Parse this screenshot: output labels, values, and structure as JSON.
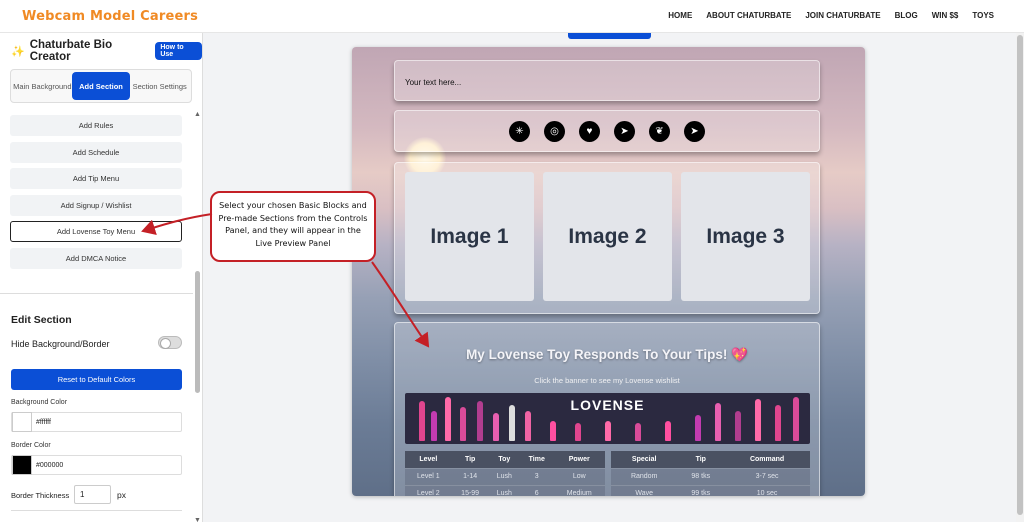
{
  "header": {
    "logo": "Webcam Model Careers",
    "nav": [
      "HOME",
      "ABOUT CHATURBATE",
      "JOIN CHATURBATE",
      "BLOG",
      "WIN $$",
      "TOYS"
    ]
  },
  "sidebar": {
    "title": "Chaturbate Bio Creator",
    "title_icon": "sparkles-icon",
    "howto": "How to Use",
    "tabs": [
      "Main Background",
      "Add Section",
      "Section Settings"
    ],
    "active_tab": "Add Section",
    "buttons": [
      "Add Rules",
      "Add Schedule",
      "Add Tip Menu",
      "Add Signup / Wishlist",
      "Add Lovense Toy Menu",
      "Add DMCA Notice"
    ],
    "edit": {
      "heading": "Edit Section",
      "hide_label": "Hide Background/Border",
      "reset": "Reset to Default Colors",
      "bg_label": "Background Color",
      "bg_value": "#ffffff",
      "border_label": "Border Color",
      "border_value": "#000000",
      "thick_label": "Border Thickness",
      "thick_value": "1",
      "thick_unit": "px"
    }
  },
  "callout": "Select your chosen Basic Blocks and Pre-made Sections from the Controls Panel, and they will appear in the Live Preview Panel",
  "preview": {
    "text_placeholder": "Your text here...",
    "socials": [
      "linktree-icon",
      "instagram-icon",
      "heart-link-icon",
      "telegram-icon",
      "onlyfans-icon",
      "telegram-icon"
    ],
    "images": [
      "Image 1",
      "Image 2",
      "Image 3"
    ],
    "lovense": {
      "title": "My Lovense Toy Responds To Your Tips!",
      "title_icon": "💖",
      "subtitle": "Click the banner to see my Lovense wishlist",
      "brand": "LOVENSE",
      "table1": {
        "headers": [
          "Level",
          "Tip",
          "Toy",
          "Time",
          "Power"
        ],
        "rows": [
          [
            "Level 1",
            "1-14",
            "Lush",
            "3",
            "Low"
          ],
          [
            "Level 2",
            "15-99",
            "Lush",
            "6",
            "Medium"
          ]
        ]
      },
      "table2": {
        "headers": [
          "Special",
          "Tip",
          "Command"
        ],
        "rows": [
          [
            "Random",
            "98 tks",
            "3-7 sec"
          ],
          [
            "Wave",
            "99 tks",
            "10 sec"
          ]
        ]
      }
    }
  },
  "colors": {
    "accent": "#0b4fd6",
    "logo": "#f08a24",
    "callout_border": "#c42026"
  }
}
